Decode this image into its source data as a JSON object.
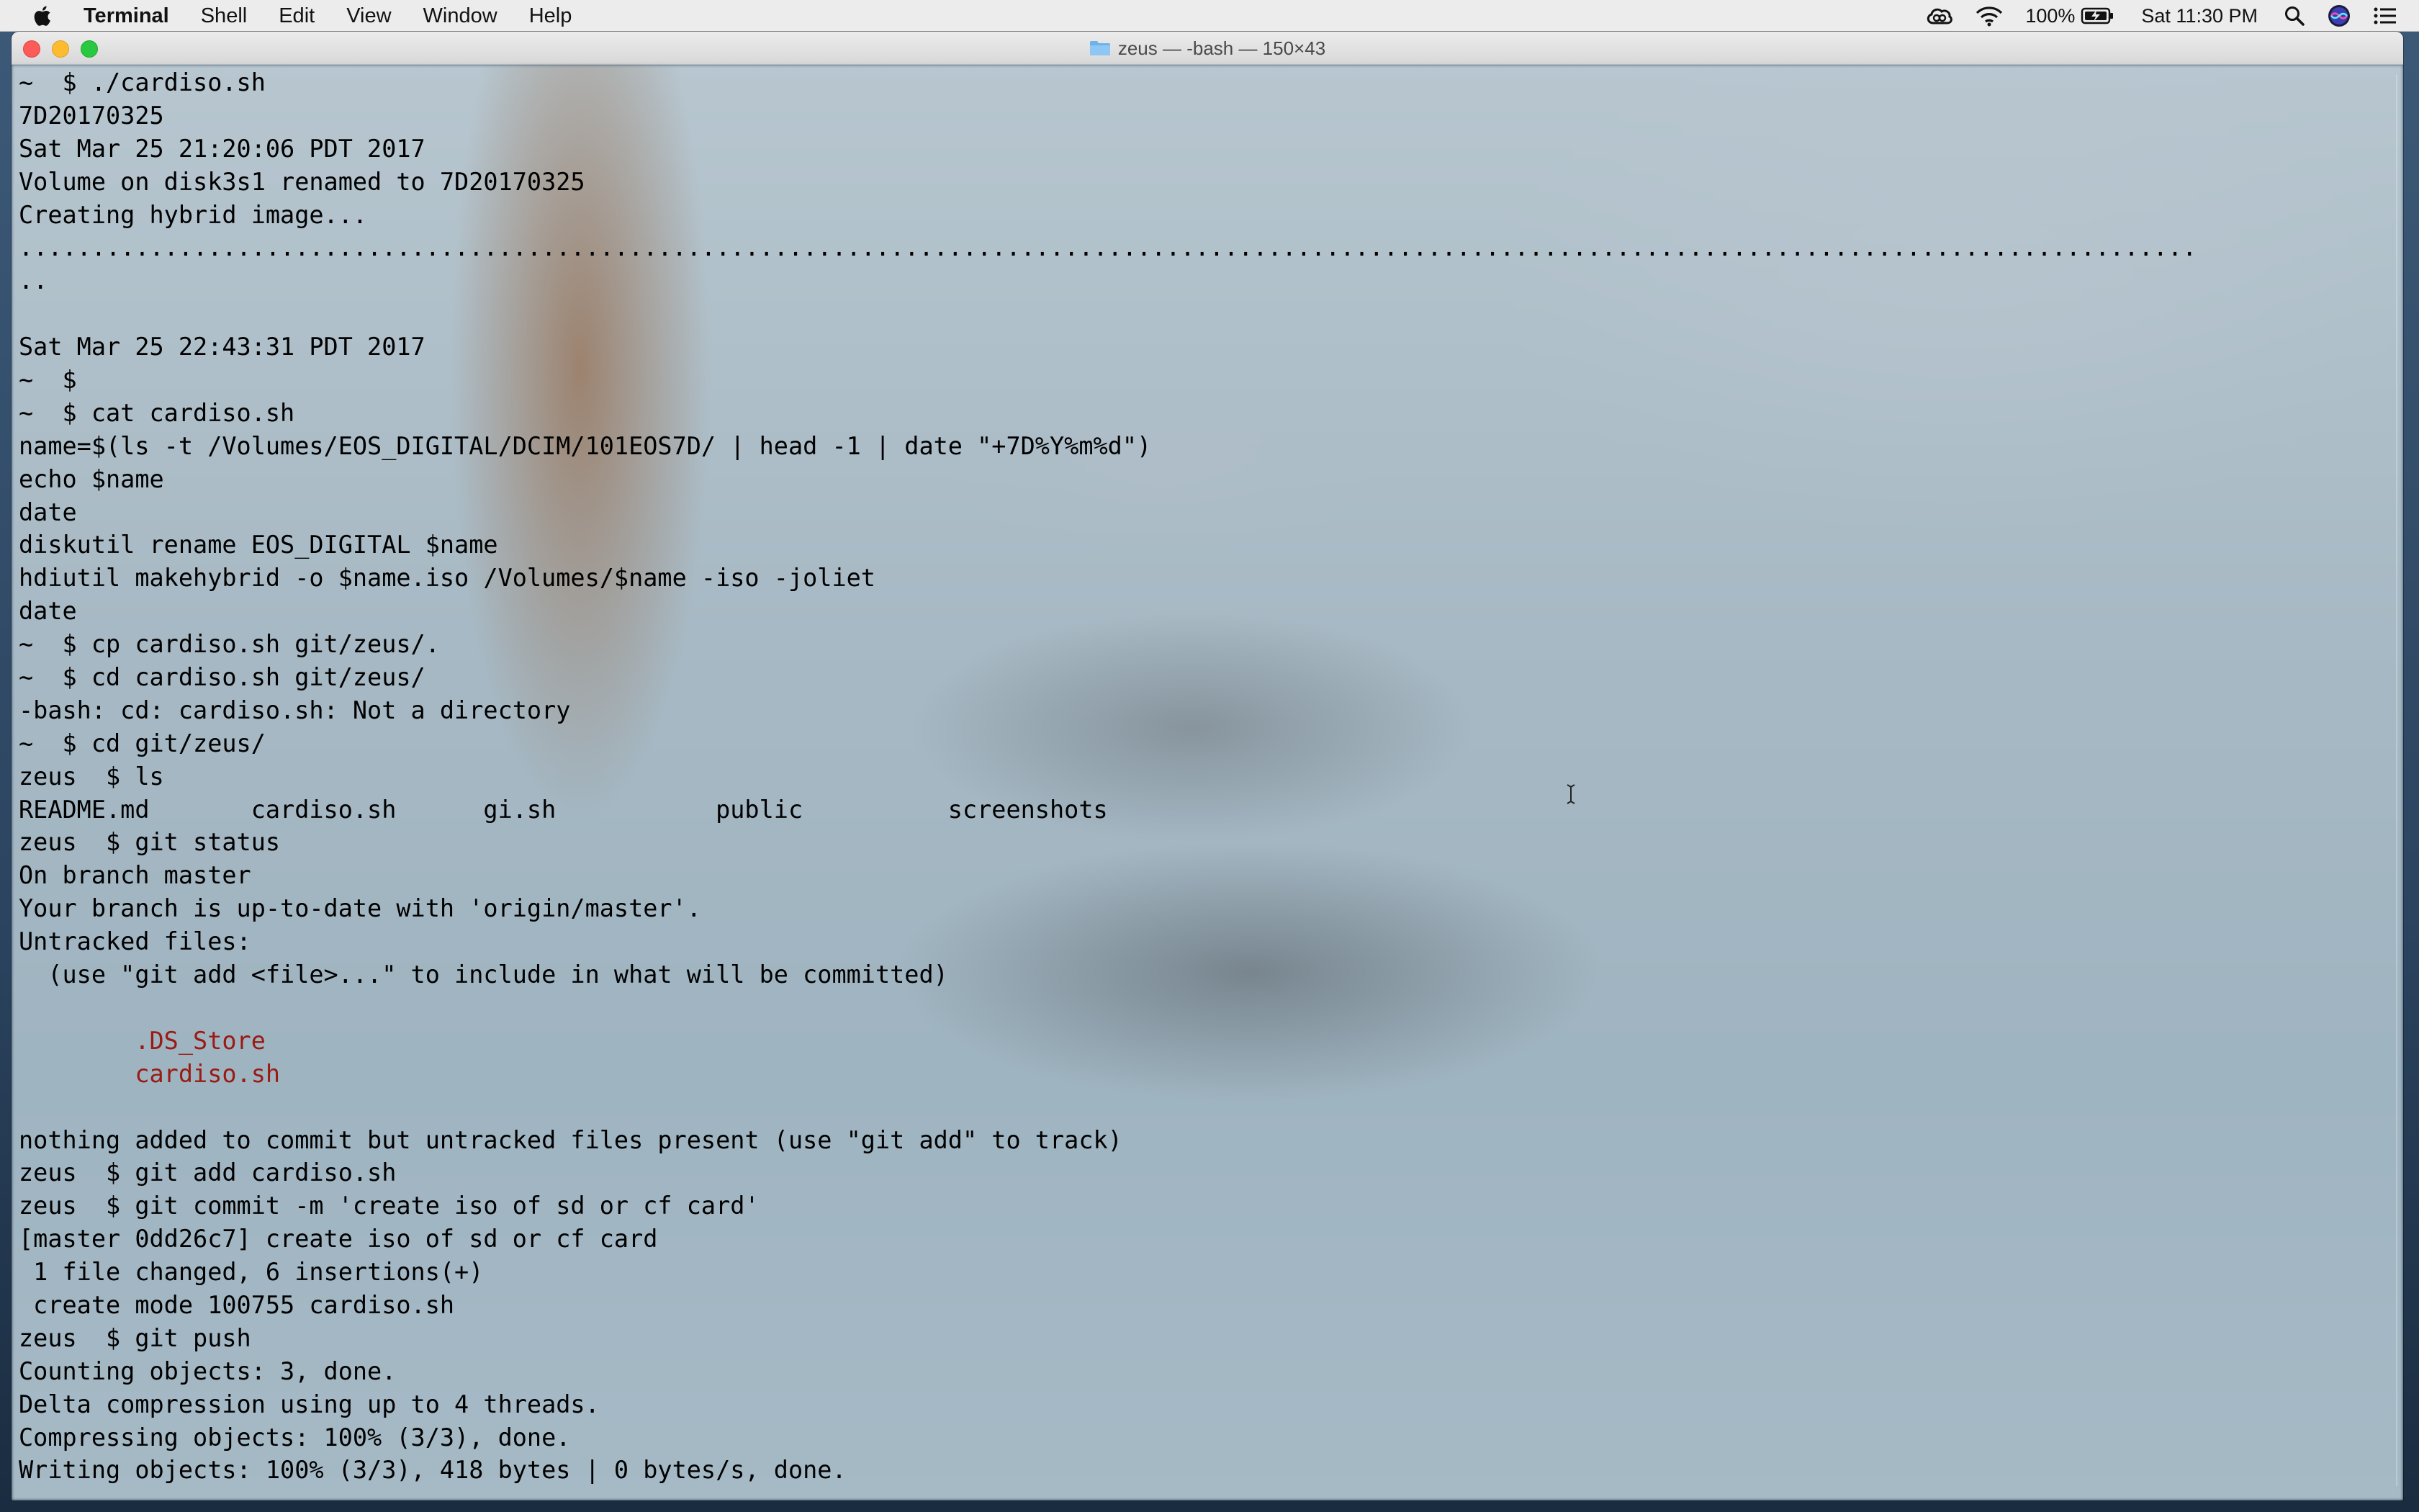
{
  "menubar": {
    "app_name": "Terminal",
    "items": [
      "Shell",
      "Edit",
      "View",
      "Window",
      "Help"
    ],
    "battery_percent": "100%",
    "clock": "Sat 11:30 PM"
  },
  "window": {
    "title": "zeus — -bash — 150×43"
  },
  "terminal": {
    "lines": [
      {
        "text": "~  $ ./cardiso.sh"
      },
      {
        "text": "7D20170325"
      },
      {
        "text": "Sat Mar 25 21:20:06 PDT 2017"
      },
      {
        "text": "Volume on disk3s1 renamed to 7D20170325"
      },
      {
        "text": "Creating hybrid image..."
      },
      {
        "text": "......................................................................................................................................................"
      },
      {
        "text": ".."
      },
      {
        "text": ""
      },
      {
        "text": "Sat Mar 25 22:43:31 PDT 2017"
      },
      {
        "text": "~  $"
      },
      {
        "text": "~  $ cat cardiso.sh"
      },
      {
        "text": "name=$(ls -t /Volumes/EOS_DIGITAL/DCIM/101EOS7D/ | head -1 | date \"+7D%Y%m%d\")"
      },
      {
        "text": "echo $name"
      },
      {
        "text": "date"
      },
      {
        "text": "diskutil rename EOS_DIGITAL $name"
      },
      {
        "text": "hdiutil makehybrid -o $name.iso /Volumes/$name -iso -joliet"
      },
      {
        "text": "date"
      },
      {
        "text": "~  $ cp cardiso.sh git/zeus/."
      },
      {
        "text": "~  $ cd cardiso.sh git/zeus/"
      },
      {
        "text": "-bash: cd: cardiso.sh: Not a directory"
      },
      {
        "text": "~  $ cd git/zeus/"
      },
      {
        "text": "zeus  $ ls"
      },
      {
        "text": "README.md       cardiso.sh      gi.sh           public          screenshots"
      },
      {
        "text": "zeus  $ git status"
      },
      {
        "text": "On branch master"
      },
      {
        "text": "Your branch is up-to-date with 'origin/master'."
      },
      {
        "text": "Untracked files:"
      },
      {
        "text": "  (use \"git add <file>...\" to include in what will be committed)"
      },
      {
        "text": ""
      },
      {
        "text": "        .DS_Store",
        "color": "red"
      },
      {
        "text": "        cardiso.sh",
        "color": "red"
      },
      {
        "text": ""
      },
      {
        "text": "nothing added to commit but untracked files present (use \"git add\" to track)"
      },
      {
        "text": "zeus  $ git add cardiso.sh"
      },
      {
        "text": "zeus  $ git commit -m 'create iso of sd or cf card'"
      },
      {
        "text": "[master 0dd26c7] create iso of sd or cf card"
      },
      {
        "text": " 1 file changed, 6 insertions(+)"
      },
      {
        "text": " create mode 100755 cardiso.sh"
      },
      {
        "text": "zeus  $ git push"
      },
      {
        "text": "Counting objects: 3, done."
      },
      {
        "text": "Delta compression using up to 4 threads."
      },
      {
        "text": "Compressing objects: 100% (3/3), done."
      },
      {
        "text": "Writing objects: 100% (3/3), 418 bytes | 0 bytes/s, done."
      }
    ]
  },
  "colors": {
    "untracked_file": "#9a1a14",
    "close_button": "#fc5b57",
    "minimize_button": "#fdbc2f",
    "zoom_button": "#28c940"
  }
}
